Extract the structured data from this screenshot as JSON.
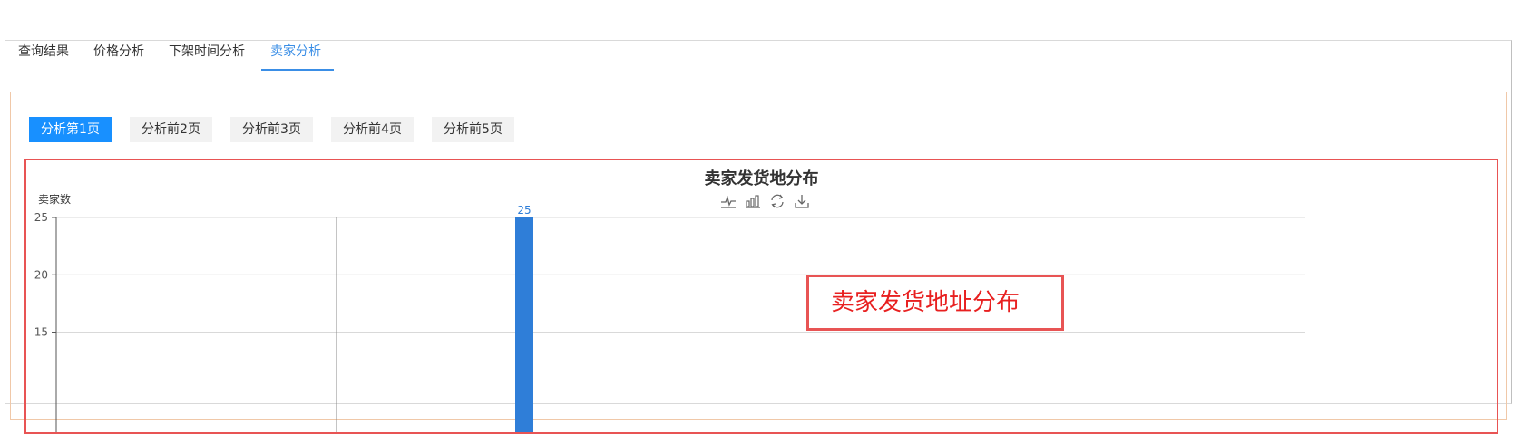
{
  "tabs": [
    {
      "label": "查询结果"
    },
    {
      "label": "价格分析"
    },
    {
      "label": "下架时间分析"
    },
    {
      "label": "卖家分析"
    }
  ],
  "active_tab": "卖家分析",
  "page_buttons": [
    {
      "label": "分析第1页"
    },
    {
      "label": "分析前2页"
    },
    {
      "label": "分析前3页"
    },
    {
      "label": "分析前4页"
    },
    {
      "label": "分析前5页"
    }
  ],
  "active_page_button": "分析第1页",
  "toolbox_icons": [
    "line-chart-icon",
    "bar-chart-icon",
    "restore-icon",
    "download-icon"
  ],
  "annotation": "卖家发货地址分布",
  "colors": {
    "accent": "#1890ff",
    "bar": "#2f7ed8",
    "annotation": "#e85454"
  },
  "chart_data": {
    "type": "bar",
    "title": "卖家发货地分布",
    "ylabel": "卖家数",
    "ylim": [
      0,
      25
    ],
    "yticks": [
      15,
      20,
      25
    ],
    "series": [
      {
        "values": [
          25
        ],
        "data_labels": [
          "25"
        ]
      }
    ]
  }
}
